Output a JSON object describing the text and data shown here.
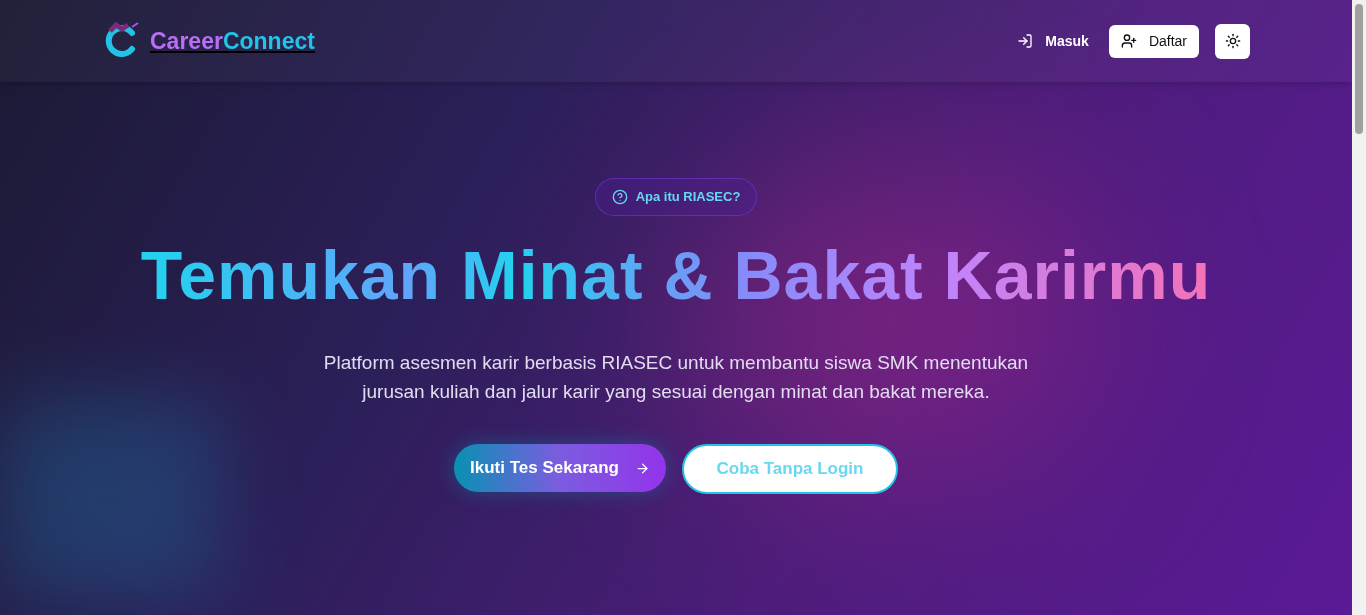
{
  "brand": {
    "part_1": "Career",
    "part_2": "Connect"
  },
  "nav": {
    "login": "Masuk",
    "register": "Daftar"
  },
  "hero": {
    "badge": "Apa itu RIASEC?",
    "heading": "Temukan Minat & Bakat Karirmu",
    "description": "Platform asesmen karir berbasis RIASEC untuk membantu siswa SMK menentukan jurusan kuliah dan jalur karir yang sesuai dengan minat dan bakat mereka.",
    "primary_button": "Ikuti Tes Sekarang",
    "secondary_button": "Coba Tanpa Login"
  }
}
